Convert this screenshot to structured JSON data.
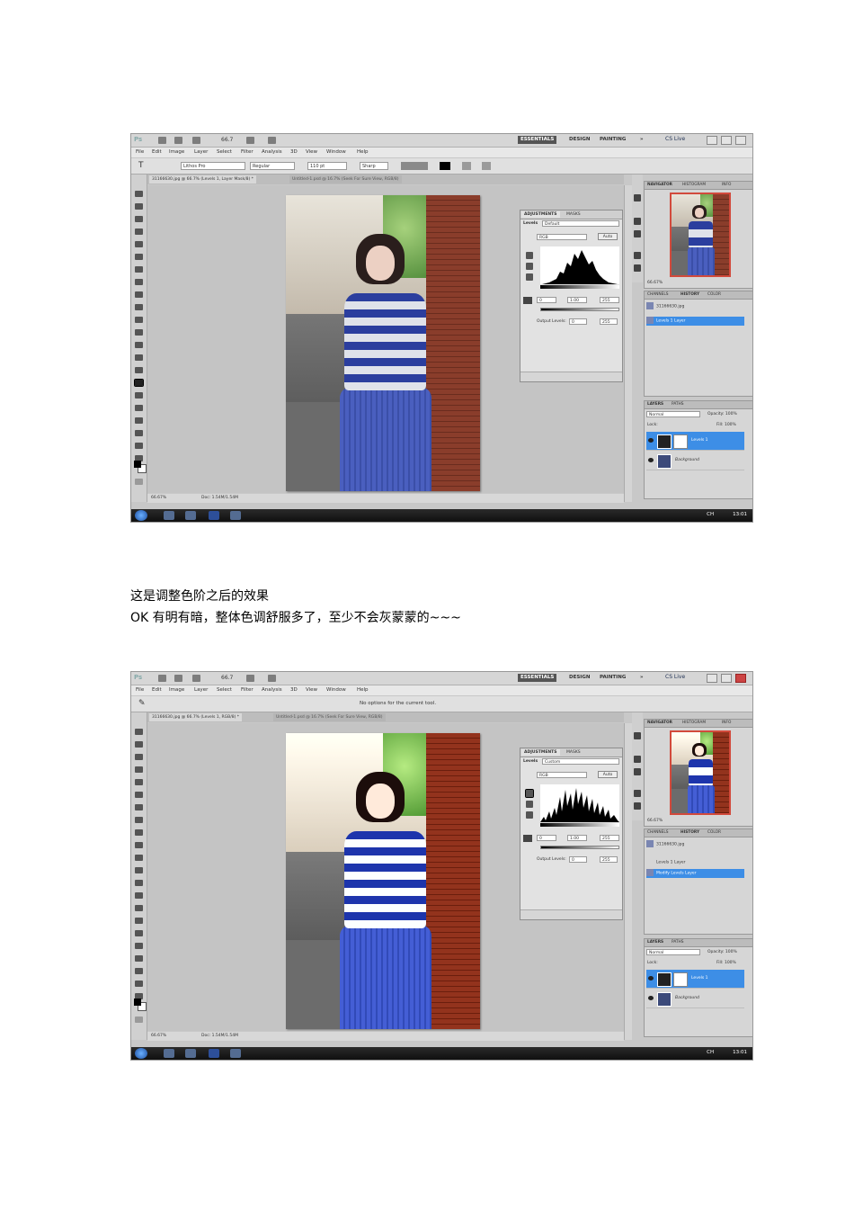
{
  "ui": {
    "logo": "Ps",
    "zoom": "66.7",
    "workspace": {
      "essentials": "ESSENTIALS",
      "design": "DESIGN",
      "painting": "PAINTING",
      "more": "»"
    },
    "cslive": "CS Live",
    "menu": [
      "File",
      "Edit",
      "Image",
      "Layer",
      "Select",
      "Filter",
      "Analysis",
      "3D",
      "View",
      "Window",
      "Help"
    ]
  },
  "screenshot1": {
    "options": {
      "tool_glyph": "T",
      "font": "Lithos Pro",
      "style": "Regular",
      "size": "110 pt",
      "aa": "Sharp"
    },
    "doc_tab_active": "31166630.jpg @ 66.7% (Levels 1, Layer Mask/8) *",
    "doc_tab_other": "Untitled-1.psd @ 16.7% (Seek For Sure View, RGB/8)",
    "status_zoom": "66.67%",
    "status_doc": "Doc: 1.54M/1.54M",
    "adjustments": {
      "tab_adjustments": "ADJUSTMENTS",
      "tab_masks": "MASKS",
      "levels_label": "Levels",
      "preset": "Default",
      "channel": "RGB",
      "auto": "Auto",
      "in_black": "0",
      "in_gamma": "1.00",
      "in_white": "255",
      "output_label": "Output Levels:",
      "out_black": "0",
      "out_white": "255"
    },
    "navigator": {
      "tab_nav": "NAVIGATOR",
      "tab_histogram": "HISTOGRAM",
      "tab_info": "INFO",
      "zoom": "66.67%"
    },
    "history": {
      "tab_channels": "CHANNELS",
      "tab_history": "HISTORY",
      "tab_color": "COLOR",
      "items": [
        "31166630.jpg",
        "Levels 1 Layer"
      ]
    },
    "layers": {
      "tab_layers": "LAYERS",
      "tab_paths": "PATHS",
      "blend": "Normal",
      "opacity": "Opacity: 100%",
      "lock": "Lock:",
      "fill": "Fill: 100%",
      "layer1": "Levels 1",
      "background": "Background"
    },
    "tray_time": "13:01",
    "tray_lang": "CH"
  },
  "caption": {
    "line1": "这是调整色阶之后的效果",
    "line2": "OK 有明有暗，整体色调舒服多了，至少不会灰蒙蒙的~~~"
  },
  "screenshot2": {
    "options": {
      "tool_glyph": "✎",
      "hint": "No options for the current tool."
    },
    "doc_tab_active": "31166630.jpg @ 66.7% (Levels 1, RGB/8) *",
    "doc_tab_other": "Untitled-1.psd @ 16.7% (Seek For Sure View, RGB/8)",
    "status_zoom": "66.67%",
    "status_doc": "Doc: 1.54M/1.54M",
    "adjustments": {
      "tab_adjustments": "ADJUSTMENTS",
      "tab_masks": "MASKS",
      "levels_label": "Levels",
      "preset": "Custom",
      "channel": "RGB",
      "auto": "Auto",
      "in_black": "0",
      "in_gamma": "1.00",
      "in_white": "255",
      "output_label": "Output Levels:",
      "out_black": "0",
      "out_white": "255"
    },
    "navigator": {
      "tab_nav": "NAVIGATOR",
      "tab_histogram": "HISTOGRAM",
      "tab_info": "INFO",
      "zoom": "66.67%"
    },
    "history": {
      "tab_channels": "CHANNELS",
      "tab_history": "HISTORY",
      "tab_color": "COLOR",
      "items": [
        "31166630.jpg",
        "Levels 1 Layer",
        "Modify Levels Layer"
      ]
    },
    "layers": {
      "tab_layers": "LAYERS",
      "tab_paths": "PATHS",
      "blend": "Normal",
      "opacity": "Opacity: 100%",
      "lock": "Lock:",
      "fill": "Fill: 100%",
      "layer1": "Levels 1",
      "background": "Background"
    },
    "tray_time": "13:01",
    "tray_lang": "CH"
  }
}
